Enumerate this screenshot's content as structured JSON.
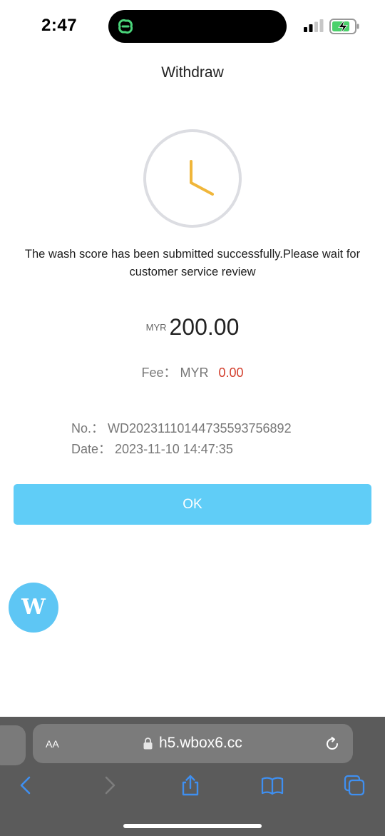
{
  "status_bar": {
    "time": "2:47"
  },
  "header": {
    "title": "Withdraw"
  },
  "result": {
    "message": "The wash score has been submitted successfully.Please wait for customer service review",
    "currency": "MYR",
    "amount": "200.00",
    "fee_label": "Fee： MYR",
    "fee_value": "0.00",
    "order_no": "No.： WD20231110144735593756892",
    "date": "Date： 2023-11-10 14:47:35"
  },
  "actions": {
    "ok_label": "OK"
  },
  "floating_button": {
    "label": "W"
  },
  "browser": {
    "aa_label": "AA",
    "url": "h5.wbox6.cc"
  },
  "colors": {
    "accent": "#60cdf7",
    "fee_value": "#d23c2a",
    "clock_hands": "#f0b63a"
  }
}
